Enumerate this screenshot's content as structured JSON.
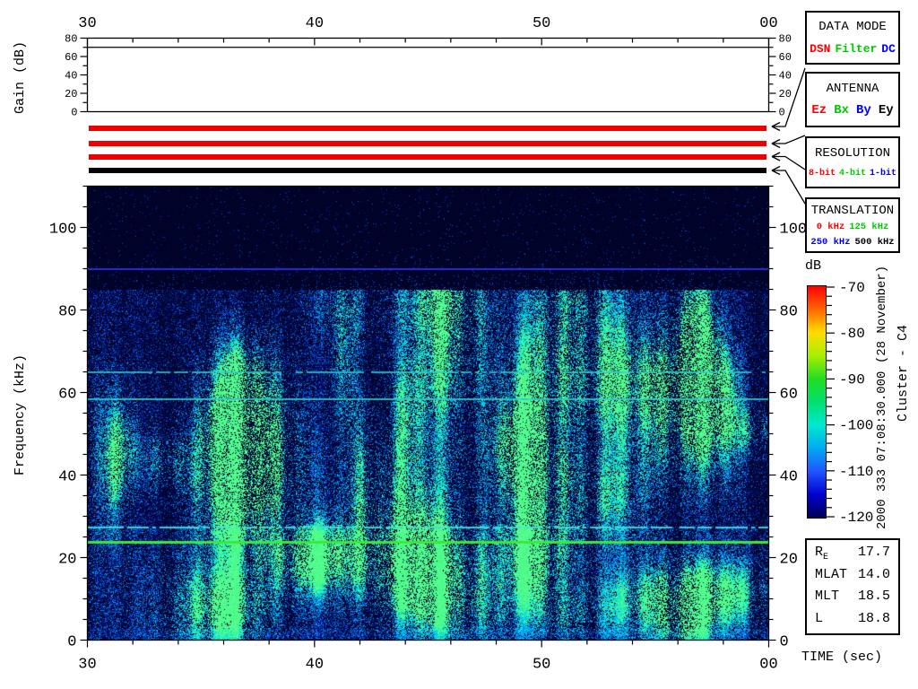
{
  "panels": {
    "data_mode": {
      "title": "DATA MODE",
      "options": [
        {
          "label": "DSN",
          "color": "#ff0000"
        },
        {
          "label": "Filter",
          "color": "#00c800"
        },
        {
          "label": "DC",
          "color": "#0000ff"
        }
      ]
    },
    "antenna": {
      "title": "ANTENNA",
      "options": [
        {
          "label": "Ez",
          "color": "#ff0000"
        },
        {
          "label": "Bx",
          "color": "#00c800"
        },
        {
          "label": "By",
          "color": "#0000ff"
        },
        {
          "label": "Ey",
          "color": "#000000"
        }
      ]
    },
    "resolution": {
      "title": "RESOLUTION",
      "options": [
        {
          "label": "8-bit",
          "color": "#ff0000"
        },
        {
          "label": "4-bit",
          "color": "#00c800"
        },
        {
          "label": "1-bit",
          "color": "#0000ff"
        }
      ]
    },
    "translation": {
      "title": "TRANSLATION",
      "options": [
        {
          "label": "0 kHz",
          "color": "#ff0000"
        },
        {
          "label": "125 kHz",
          "color": "#00c800"
        },
        {
          "label": "250 kHz",
          "color": "#0000ff"
        },
        {
          "label": "500 kHz",
          "color": "#000000"
        }
      ]
    }
  },
  "status_bars": [
    {
      "name": "data-mode-status-bar",
      "color": "#ee0000"
    },
    {
      "name": "antenna-status-bar",
      "color": "#ee0000"
    },
    {
      "name": "resolution-status-bar",
      "color": "#ee0000"
    },
    {
      "name": "translation-status-bar",
      "color": "#000000"
    }
  ],
  "ephemeris": {
    "rows": [
      {
        "label": "R",
        "sub": "E",
        "value": "17.7"
      },
      {
        "label": "MLAT",
        "sub": "",
        "value": "14.0"
      },
      {
        "label": "MLT",
        "sub": "",
        "value": "18.5"
      },
      {
        "label": "L",
        "sub": "",
        "value": "18.8"
      }
    ]
  },
  "annotations": {
    "datetime": "2000 333 07:08:30.000 (28 November)",
    "spacecraft": "Cluster - C4",
    "colorbar_title": "dB",
    "time_axis_title": "TIME (sec)"
  },
  "chart_data": [
    {
      "id": "gain-monitor",
      "type": "line",
      "title": "",
      "ylabel": "Gain (dB)",
      "ylim": [
        0,
        80
      ],
      "yticks": [
        0,
        20,
        40,
        60,
        80
      ],
      "y_minor_step": 10,
      "xlim_sec": [
        30,
        60
      ],
      "xticks": [
        {
          "v": 30,
          "label": "30"
        },
        {
          "v": 40,
          "label": "40"
        },
        {
          "v": 50,
          "label": "50"
        },
        {
          "v": 60,
          "label": "00"
        }
      ],
      "x_minor_step": 2,
      "series": [
        {
          "name": "receiver-gain",
          "x_sec": [
            30,
            60
          ],
          "values_dB": [
            70,
            70
          ]
        }
      ]
    },
    {
      "id": "wideband-spectrogram",
      "type": "heatmap",
      "title": "",
      "xlabel": "TIME (sec)",
      "ylabel": "Frequency (kHz)",
      "xlim_sec": [
        30,
        60
      ],
      "xticks": [
        {
          "v": 30,
          "label": "30"
        },
        {
          "v": 40,
          "label": "40"
        },
        {
          "v": 50,
          "label": "50"
        },
        {
          "v": 60,
          "label": "00"
        }
      ],
      "x_minor_step": 2,
      "ylim_kHz": [
        0,
        110
      ],
      "yticks": [
        0,
        20,
        40,
        60,
        80,
        100
      ],
      "y_minor_step": 5,
      "background_color": "#000228",
      "noise": {
        "seed": 20001128,
        "ceiling_kHz": 85,
        "upper_quiet_kHz": 91.5,
        "bottom_band_top_kHz": 28
      },
      "spectral_lines": [
        {
          "f_kHz": 90,
          "color": "#2a35e0",
          "width": 2,
          "alpha": 0.9,
          "style": "solid"
        },
        {
          "f_kHz": 65,
          "color": "#38cccc",
          "width": 2,
          "alpha": 0.8,
          "style": "dashed"
        },
        {
          "f_kHz": 58.5,
          "color": "#38cccc",
          "width": 2,
          "alpha": 0.85,
          "style": "solid"
        },
        {
          "f_kHz": 27.5,
          "color": "#48dcdc",
          "width": 2,
          "alpha": 0.9,
          "style": "dashed"
        },
        {
          "f_kHz": 24,
          "color": "#3ce83c",
          "width": 3,
          "alpha": 1,
          "style": "solid"
        }
      ],
      "colorbar": {
        "title": "dB",
        "min": -120,
        "max": -70,
        "ticks": [
          -70,
          -80,
          -90,
          -100,
          -110,
          -120
        ],
        "minor_step": 2,
        "gradient_stops_top_to_bottom": [
          "#ff0000",
          "#ff6600",
          "#ffdd00",
          "#aaee00",
          "#22dd22",
          "#00e070",
          "#00e8d0",
          "#00aaf0",
          "#2255ff",
          "#0000d0",
          "#000055"
        ]
      }
    }
  ]
}
